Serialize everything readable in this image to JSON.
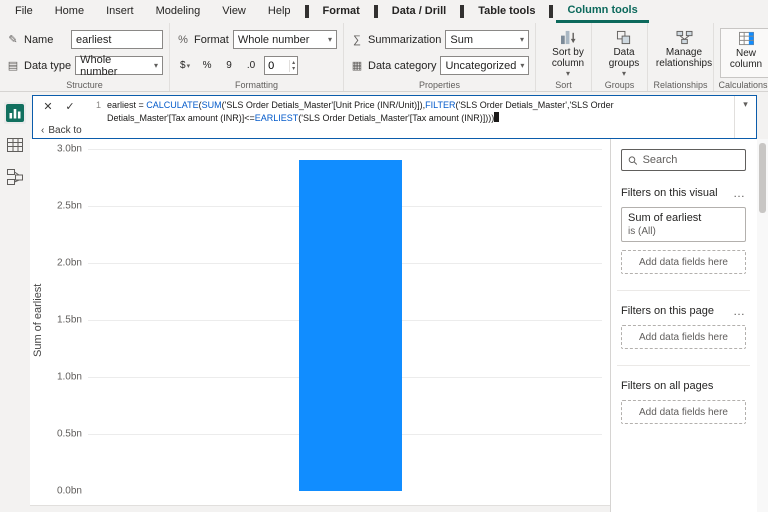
{
  "menu": {
    "tabs": [
      {
        "label": "File"
      },
      {
        "label": "Home"
      },
      {
        "label": "Insert"
      },
      {
        "label": "Modeling"
      },
      {
        "label": "View"
      },
      {
        "label": "Help"
      },
      {
        "label": "Format"
      },
      {
        "label": "Data / Drill"
      },
      {
        "label": "Table tools"
      },
      {
        "label": "Column tools"
      }
    ],
    "active_tab": "Column tools",
    "accent_color": "#0c695c"
  },
  "icons": {
    "pencil": "✎",
    "datatype": "▤",
    "format": "%",
    "sigma": "∑",
    "category": "▦",
    "chevron_down": "▾",
    "chevron_up": "▴",
    "chevron_left": "‹",
    "close": "✕",
    "check": "✓",
    "more": "…",
    "dollar": "$",
    "percent": "%",
    "thousands": "9",
    "decimal": ".0"
  },
  "ribbon": {
    "structure": {
      "group_label": "Structure",
      "name_label": "Name",
      "name_value": "earliest",
      "datatype_label": "Data type",
      "datatype_value": "Whole number"
    },
    "formatting": {
      "group_label": "Formatting",
      "format_label": "Format",
      "format_value": "Whole number",
      "decimals_value": "0"
    },
    "properties": {
      "group_label": "Properties",
      "summarization_label": "Summarization",
      "summarization_value": "Sum",
      "datacategory_label": "Data category",
      "datacategory_value": "Uncategorized"
    },
    "sort": {
      "group_label": "Sort",
      "button_label": "Sort by column"
    },
    "groups": {
      "group_label": "Groups",
      "button_label": "Data groups"
    },
    "relationships": {
      "group_label": "Relationships",
      "button_label": "Manage relationships"
    },
    "calculations": {
      "group_label": "Calculations",
      "button_label": "New column"
    }
  },
  "formula_bar": {
    "line1_number": "1",
    "keyword_color": "#035aca",
    "back_label": "Back to",
    "lines": [
      [
        {
          "t": "earliest = ",
          "k": "plain"
        },
        {
          "t": "CALCULATE",
          "k": "fn"
        },
        {
          "t": "(",
          "k": "plain"
        },
        {
          "t": "SUM",
          "k": "fn"
        },
        {
          "t": "('SLS Order Detials_Master'[Unit Price (INR/Unit)]),",
          "k": "plain"
        },
        {
          "t": "FILTER",
          "k": "fn"
        },
        {
          "t": "('SLS Order Detials_Master','SLS Order",
          "k": "plain"
        }
      ],
      [
        {
          "t": "Detials_Master'[Tax amount (INR)]<=",
          "k": "plain"
        },
        {
          "t": "EARLIEST",
          "k": "fn"
        },
        {
          "t": "('SLS Order Detials_Master'[Tax amount (INR)])))",
          "k": "plain"
        }
      ]
    ]
  },
  "sidebar": {
    "items": [
      {
        "name": "report-view",
        "active": true
      },
      {
        "name": "data-view",
        "active": false
      },
      {
        "name": "model-view",
        "active": false
      }
    ]
  },
  "chart_data": {
    "type": "bar",
    "categories": [
      ""
    ],
    "values": [
      2900000000
    ],
    "series_name": "earliest",
    "title": "",
    "xlabel": "",
    "ylabel": "Sum of earliest",
    "ylim": [
      0,
      3000000000
    ],
    "ytick_labels": [
      "3.0bn",
      "2.5bn",
      "2.0bn",
      "1.5bn",
      "1.0bn",
      "0.5bn",
      "0.0bn"
    ],
    "bar_color": "#118DFF",
    "grid": true,
    "legend": false
  },
  "filters": {
    "search_placeholder": "Search",
    "sections": [
      {
        "title": "Filters on this visual",
        "card": {
          "field": "Sum of earliest",
          "condition": "is (All)"
        },
        "add_label": "Add data fields here"
      },
      {
        "title": "Filters on this page",
        "add_label": "Add data fields here"
      },
      {
        "title": "Filters on all pages",
        "add_label": "Add data fields here"
      }
    ]
  }
}
